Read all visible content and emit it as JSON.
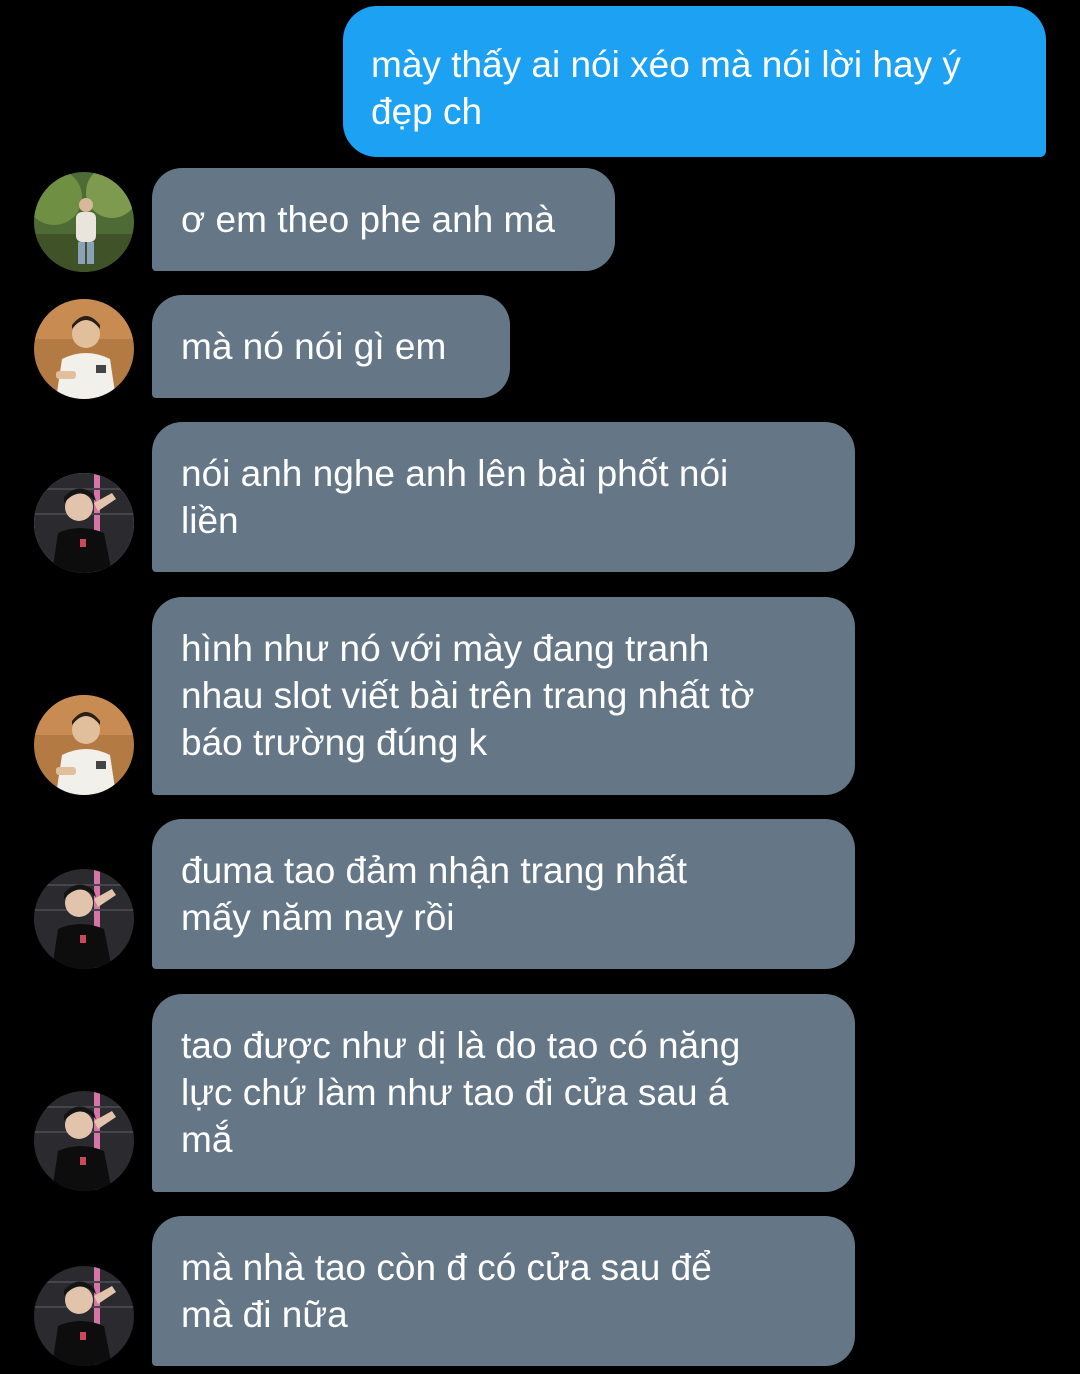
{
  "colors": {
    "background": "#000000",
    "sent_bubble": "#1da1f2",
    "received_bubble": "#657786",
    "text": "#ffffff"
  },
  "conversation": {
    "messages": [
      {
        "direction": "sent",
        "text": "mày thấy ai nói xéo mà nói lời hay ý\nđẹp ch"
      },
      {
        "direction": "received",
        "avatar": "avatar-garden-photo",
        "text": "ơ em theo phe anh mà"
      },
      {
        "direction": "received",
        "avatar": "avatar-white-shirt-photo",
        "text": "mà nó nói gì em"
      },
      {
        "direction": "received",
        "avatar": "avatar-black-shirt-photo",
        "text": "nói anh nghe anh lên bài phốt nói\nliền"
      },
      {
        "direction": "received",
        "avatar": "avatar-white-shirt-photo",
        "text": "hình như nó với mày đang tranh\nnhau slot viết bài trên trang nhất tờ\nbáo trường đúng k"
      },
      {
        "direction": "received",
        "avatar": "avatar-black-shirt-photo",
        "text": "đuma tao đảm nhận trang nhất\nmấy năm nay rồi"
      },
      {
        "direction": "received",
        "avatar": "avatar-black-shirt-photo",
        "text": "tao được như dị là do tao có năng\nlực chứ làm như tao đi cửa sau á\nmắ"
      },
      {
        "direction": "received",
        "avatar": "avatar-black-shirt-photo",
        "text": "mà nhà tao còn đ có cửa sau để\nmà đi nữa"
      }
    ]
  }
}
